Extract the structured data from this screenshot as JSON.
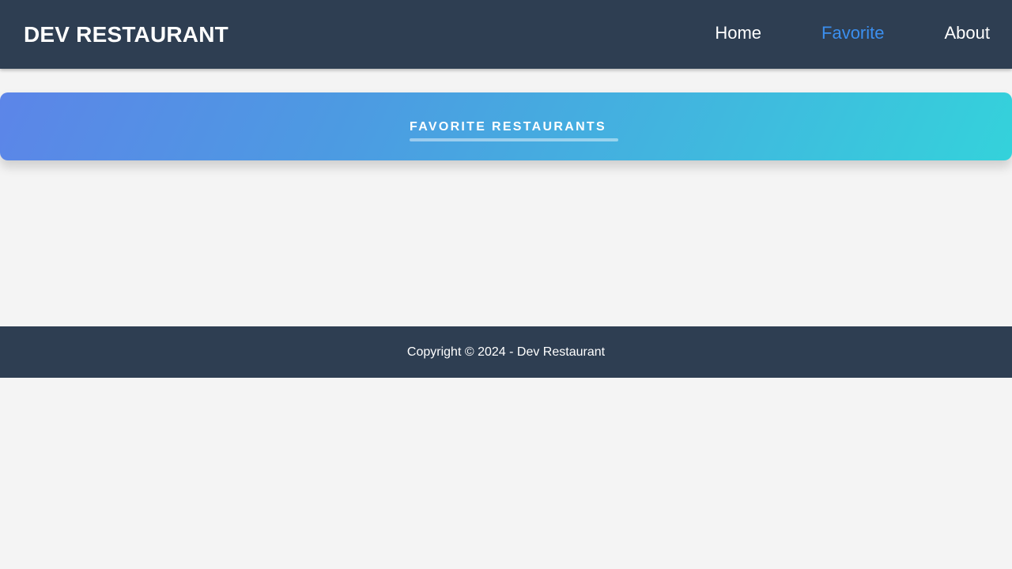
{
  "header": {
    "brand": "DEV RESTAURANT",
    "nav": [
      {
        "label": "Home",
        "active": false
      },
      {
        "label": "Favorite",
        "active": true
      },
      {
        "label": "About",
        "active": false
      }
    ],
    "active_color": "#3b8fef",
    "background_color": "#2e3e52"
  },
  "banner": {
    "title": "FAVORITE RESTAURANTS",
    "gradient": [
      "#5c85e8",
      "#34d2db"
    ]
  },
  "footer": {
    "text": "Copyright © 2024 - Dev Restaurant"
  }
}
